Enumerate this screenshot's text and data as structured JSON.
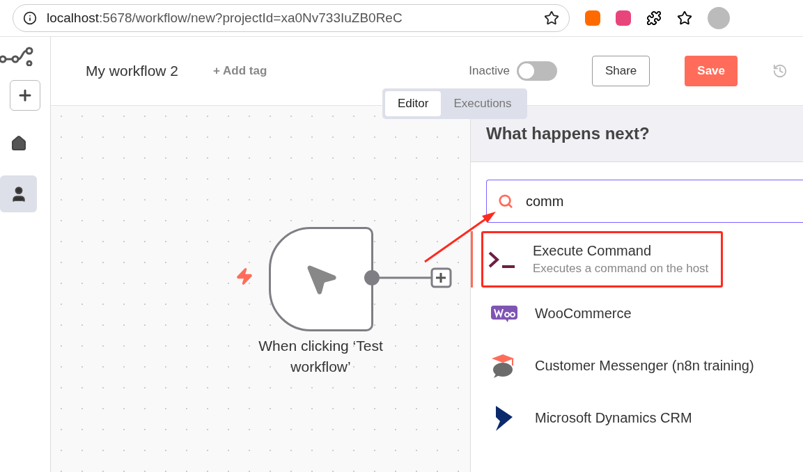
{
  "browser": {
    "url_host": "localhost",
    "url_rest": ":5678/workflow/new?projectId=xa0Nv733IuZB0ReC"
  },
  "sidebar": {
    "items": [
      {
        "kind": "add",
        "selected": false
      },
      {
        "kind": "home",
        "selected": false
      },
      {
        "kind": "user",
        "selected": true
      }
    ]
  },
  "header": {
    "title": "My workflow 2",
    "add_tag": "+ Add tag",
    "status_label": "Inactive",
    "active": false,
    "share": "Share",
    "save": "Save"
  },
  "tabs": [
    {
      "label": "Editor",
      "selected": true
    },
    {
      "label": "Executions",
      "selected": false
    }
  ],
  "canvas": {
    "node": {
      "label": "When clicking ‘Test workflow’"
    }
  },
  "panel": {
    "title": "What happens next?",
    "search": {
      "value": "comm"
    },
    "items": [
      {
        "kind": "terminal",
        "name": "Execute Command",
        "description": "Executes a command on the host",
        "selected": true,
        "annotated": true
      },
      {
        "kind": "woo",
        "name": "WooCommerce",
        "selected": false,
        "annotated": false
      },
      {
        "kind": "messenger",
        "name": "Customer Messenger (n8n training)",
        "selected": false,
        "annotated": false
      },
      {
        "kind": "dynamics",
        "name": "Microsoft Dynamics CRM",
        "selected": false,
        "annotated": false
      }
    ]
  }
}
